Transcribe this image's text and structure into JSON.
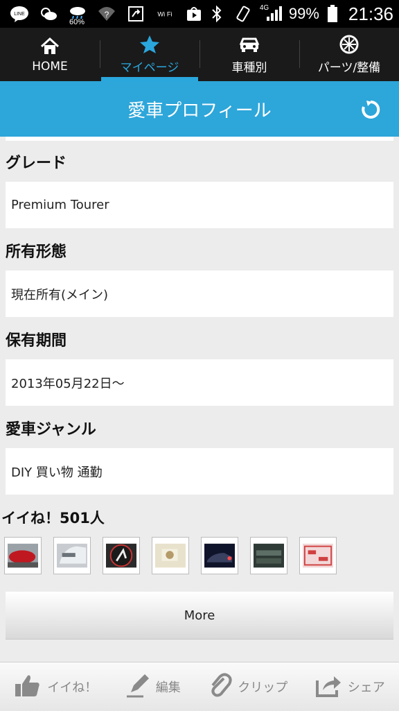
{
  "status_bar": {
    "line_label": "LINE",
    "weather_percent": "60%",
    "wifi_label": "Wi Fi",
    "network": "4G",
    "battery": "99%",
    "time": "21:36"
  },
  "nav": {
    "tabs": [
      {
        "label": "HOME",
        "icon": "home-icon"
      },
      {
        "label": "マイページ",
        "icon": "star-icon",
        "active": true
      },
      {
        "label": "車種別",
        "icon": "car-icon"
      },
      {
        "label": "パーツ/整備",
        "icon": "wheel-icon"
      }
    ]
  },
  "header": {
    "title": "愛車プロフィール"
  },
  "profile": {
    "grade_label": "グレード",
    "grade_value": "Premium Tourer",
    "ownership_label": "所有形態",
    "ownership_value": "現在所有(メイン)",
    "period_label": "保有期間",
    "period_value": "2013年05月22日〜",
    "genre_label": "愛車ジャンル",
    "genre_value": "DIY 買い物 通勤"
  },
  "likes": {
    "title": "イイね！501人",
    "thumbnail_count": 7
  },
  "more_label": "More",
  "toolbar": {
    "like_label": "イイね！",
    "edit_label": "編集",
    "clip_label": "クリップ",
    "share_label": "シェア"
  },
  "colors": {
    "accent": "#2da6da",
    "nav_bg": "#1a1a1a",
    "page_bg": "#ececec"
  }
}
